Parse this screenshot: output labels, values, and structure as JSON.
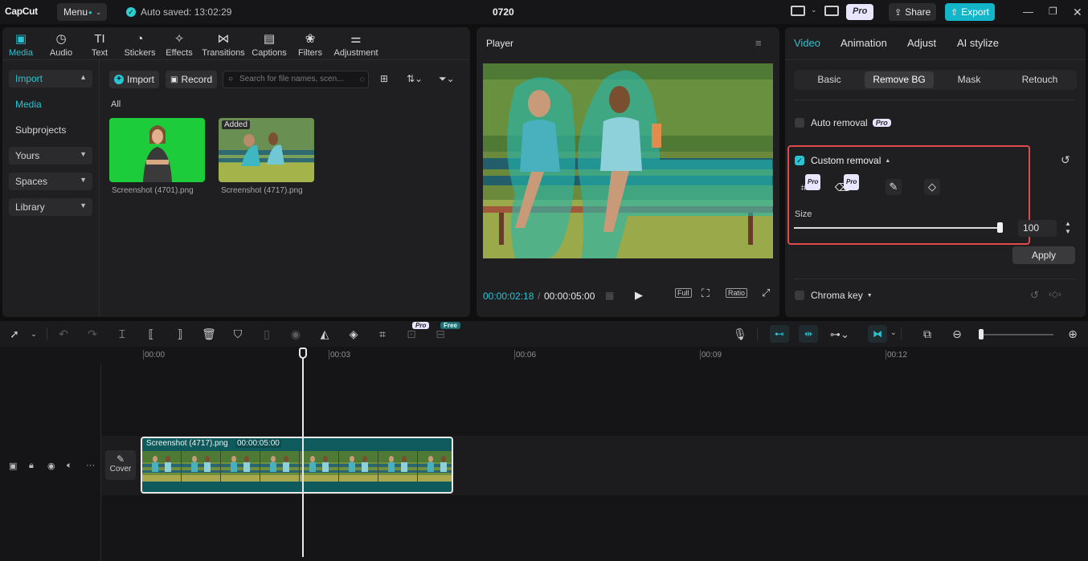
{
  "topbar": {
    "logo": "CapCut",
    "menu_label": "Menu",
    "autosave": "Auto saved: 13:02:29",
    "project_title": "0720",
    "pro_label": "Pro",
    "share_label": "Share",
    "export_label": "Export"
  },
  "media": {
    "tabs": [
      {
        "label": "Media",
        "icon": "media-icon"
      },
      {
        "label": "Audio",
        "icon": "audio-icon"
      },
      {
        "label": "Text",
        "icon": "text-icon"
      },
      {
        "label": "Stickers",
        "icon": "stickers-icon"
      },
      {
        "label": "Effects",
        "icon": "effects-icon"
      },
      {
        "label": "Transitions",
        "icon": "transitions-icon"
      },
      {
        "label": "Captions",
        "icon": "captions-icon"
      },
      {
        "label": "Filters",
        "icon": "filters-icon"
      },
      {
        "label": "Adjustment",
        "icon": "adjustment-icon"
      }
    ],
    "sidebar": [
      "Import",
      "Media",
      "Subprojects",
      "Yours",
      "Spaces",
      "Library"
    ],
    "import_label": "Import",
    "record_label": "Record",
    "search_placeholder": "Search for file names, scen...",
    "filter_all": "All",
    "items": [
      {
        "name": "Screenshot (4701).png",
        "badge": ""
      },
      {
        "name": "Screenshot (4717).png",
        "badge": "Added"
      }
    ]
  },
  "player": {
    "title": "Player",
    "current_time": "00:00:02:18",
    "total_time": "00:00:05:00",
    "full_label": "Full",
    "ratio_label": "Ratio"
  },
  "props": {
    "tabs": [
      "Video",
      "Animation",
      "Adjust",
      "AI stylize"
    ],
    "sub_tabs": [
      "Basic",
      "Remove BG",
      "Mask",
      "Retouch"
    ],
    "auto_removal": "Auto removal",
    "pro_tag": "Pro",
    "custom_removal": "Custom removal",
    "size_label": "Size",
    "size_value": "100",
    "size_fraction": 1.0,
    "apply_label": "Apply",
    "chroma_key": "Chroma key"
  },
  "timeline": {
    "ruler": [
      "00:00",
      "00:03",
      "00:06",
      "00:09",
      "00:12"
    ],
    "clip_name": "Screenshot (4717).png",
    "clip_duration": "00:00:05:00",
    "cover_label": "Cover",
    "tag_pro": "Pro",
    "tag_free": "Free"
  },
  "colors": {
    "accent": "#27c5d3",
    "export": "#13b5c8",
    "highlight": "#e24b4b"
  }
}
